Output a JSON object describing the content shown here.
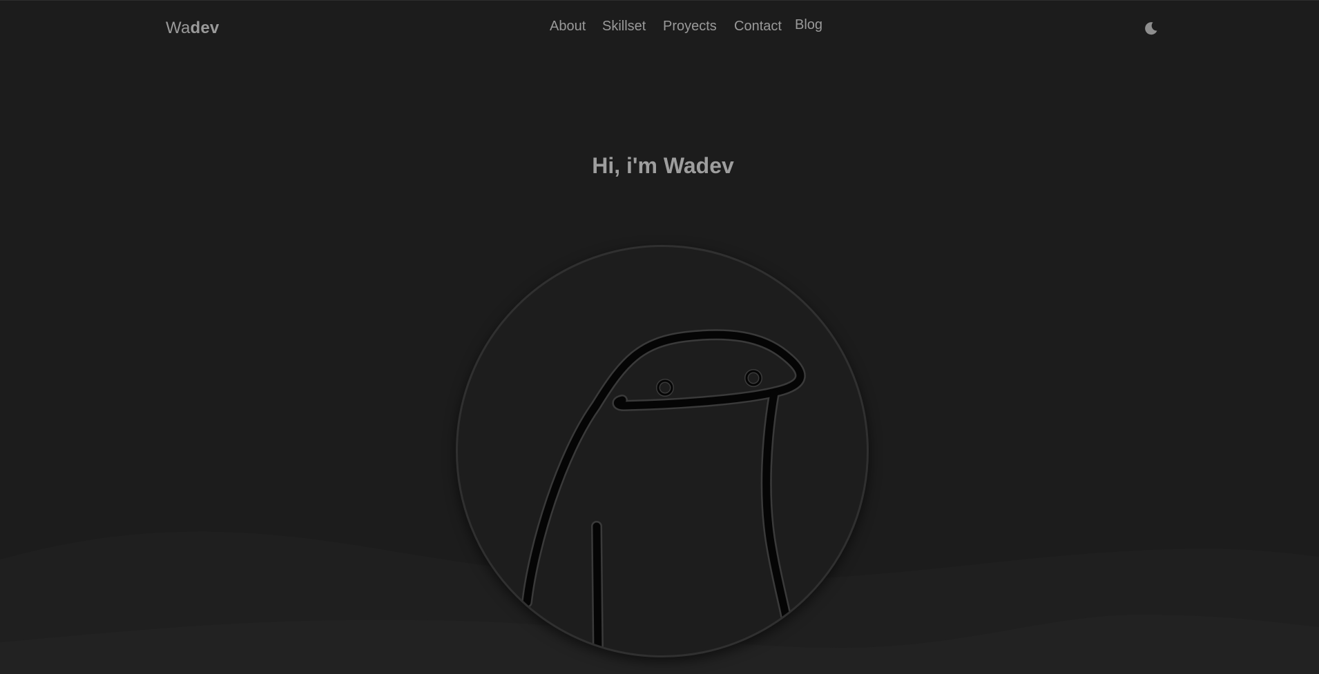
{
  "brand": {
    "prefix": "Wa",
    "suffix": "dev"
  },
  "nav": {
    "items": [
      {
        "label": "About"
      },
      {
        "label": "Skillset"
      },
      {
        "label": "Proyects"
      },
      {
        "label": "Contact"
      },
      {
        "label": "Blog"
      }
    ]
  },
  "theme_toggle": {
    "icon": "moon-icon"
  },
  "hero": {
    "greeting": "Hi, i'm",
    "name": "Wadev"
  },
  "avatar": {
    "icon": "flork-doodle-illustration"
  },
  "colors": {
    "background": "#1c1c1c",
    "text": "#9a9a9a",
    "wave_light": "#222222",
    "wave_dark": "#1f1f1f"
  }
}
